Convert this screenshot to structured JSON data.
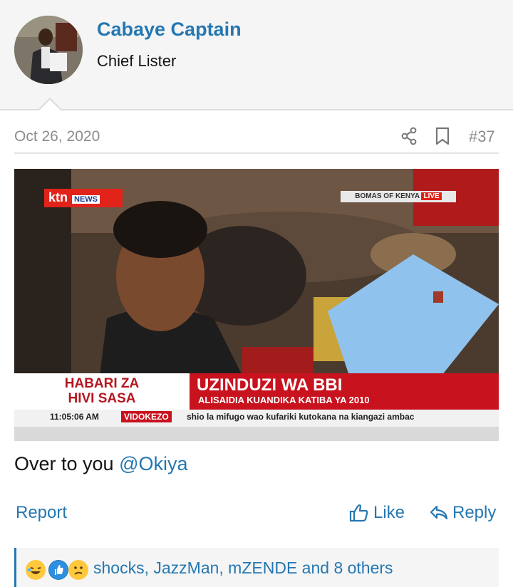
{
  "author": {
    "username": "Cabaye Captain",
    "user_title": "Chief Lister"
  },
  "post": {
    "date": "Oct 26, 2020",
    "number": "#37",
    "body_text": "Over to you ",
    "mention": "@Okiya"
  },
  "news_image": {
    "channel": "ktn",
    "channel_sub": "NEWS",
    "live_source": "BOMAS OF KENYA",
    "live_label": "LIVE",
    "banner_left": [
      "HABARI ZA",
      "HIVI SASA"
    ],
    "headline": "UZINDUZI WA BBI",
    "subheadline": "ALISAIDIA KUANDIKA KATIBA YA 2010",
    "time": "11:05:06 AM",
    "ticker_tag": "VIDOKEZO",
    "ticker_text": "shio la mifugo wao kufariki kutokana na kiangazi ambac"
  },
  "actions": {
    "report": "Report",
    "like": "Like",
    "reply": "Reply"
  },
  "reactions": {
    "icons": [
      "laugh-icon",
      "like-reaction-icon",
      "confused-icon"
    ],
    "text": "shocks, JazzMan, mZENDE and 8 others"
  },
  "colors": {
    "accent": "#2577b1",
    "meta_gray": "#8c8c8c",
    "banner_red": "#c8131f"
  }
}
